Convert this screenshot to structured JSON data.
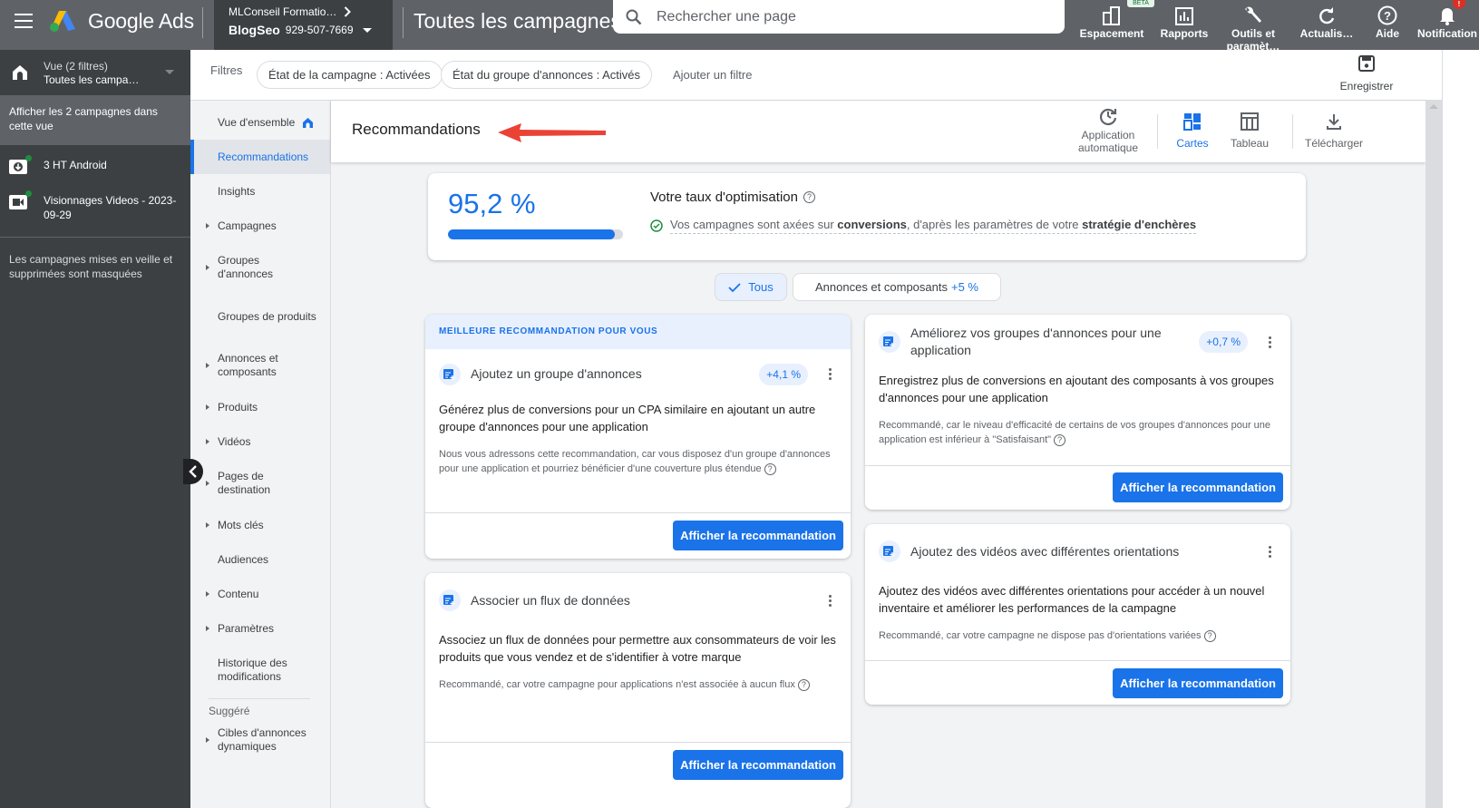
{
  "topbar": {
    "brand": "Google Ads",
    "account_parent": "MLConseil Formatio…",
    "account_name": "BlogSeo",
    "account_id": "929-507-7669",
    "page_title": "Toutes les campagnes",
    "search_placeholder": "Rechercher une page",
    "beta_badge": "BETA",
    "notification_count": "!",
    "tools": [
      {
        "label": "Espacement",
        "icon": "workspace-icon"
      },
      {
        "label": "Rapports",
        "icon": "reports-icon"
      },
      {
        "label": "Outils et paramèt…",
        "icon": "wrench-icon"
      },
      {
        "label": "Actualis…",
        "icon": "refresh-icon"
      },
      {
        "label": "Aide",
        "icon": "help-icon"
      },
      {
        "label": "Notification",
        "icon": "bell-icon"
      }
    ]
  },
  "leftpanel": {
    "view_line1": "Vue (2 filtres)",
    "view_line2": "Toutes les campa…",
    "show_all": "Afficher les 2 campagnes dans cette vue",
    "campaigns": [
      {
        "name": "3 HT Android",
        "icon": "app-download-icon",
        "status_color": "#1e8e3e"
      },
      {
        "name": "Visionnages Videos - 2023-09-29",
        "icon": "video-camera-icon",
        "status_color": "#1e8e3e"
      }
    ],
    "hidden_note": "Les campagnes mises en veille et supprimées sont masquées"
  },
  "filterbar": {
    "label": "Filtres",
    "chips": [
      "État de la campagne : Activées",
      "État du groupe d'annonces : Activés"
    ],
    "add_filter": "Ajouter un filtre",
    "save_label": "Enregistrer"
  },
  "nav": {
    "items": [
      {
        "label": "Vue d'ensemble",
        "expandable": false,
        "home": true
      },
      {
        "label": "Recommandations",
        "expandable": false,
        "active": true
      },
      {
        "label": "Insights",
        "expandable": false
      },
      {
        "label": "Campagnes",
        "expandable": true
      },
      {
        "label": "Groupes d'annonces",
        "expandable": true
      },
      {
        "label": "Groupes de produits",
        "expandable": false
      },
      {
        "label": "Annonces et composants",
        "expandable": true
      },
      {
        "label": "Produits",
        "expandable": true
      },
      {
        "label": "Vidéos",
        "expandable": true
      },
      {
        "label": "Pages de destination",
        "expandable": true
      },
      {
        "label": "Mots clés",
        "expandable": true
      },
      {
        "label": "Audiences",
        "expandable": false
      },
      {
        "label": "Contenu",
        "expandable": true
      },
      {
        "label": "Paramètres",
        "expandable": true
      },
      {
        "label": "Historique des modifications",
        "expandable": false
      }
    ],
    "section_label": "Suggéré",
    "suggested": [
      {
        "label": "Cibles d'annonces dynamiques",
        "expandable": true
      }
    ]
  },
  "header": {
    "title": "Recommandations",
    "tools": [
      {
        "label": "Application automatique",
        "icon": "auto-apply-icon"
      },
      {
        "label": "Cartes",
        "icon": "cards-view-icon",
        "active": true
      },
      {
        "label": "Tableau",
        "icon": "table-view-icon"
      },
      {
        "label": "Télécharger",
        "icon": "download-icon"
      }
    ]
  },
  "score": {
    "value": "95,2 %",
    "progress_percent": 95.2,
    "title": "Votre taux d'optimisation",
    "desc_pre": "Vos campagnes sont axées sur ",
    "desc_bold1": "conversions",
    "desc_mid": ", d'après les paramètres de votre ",
    "desc_bold2": "stratégie d'enchères"
  },
  "segments": {
    "all_label": "Tous",
    "ads_label": "Annonces et composants",
    "ads_uplift": "+5 %"
  },
  "cards": [
    {
      "banner": "MEILLEURE RECOMMANDATION POUR VOUS",
      "title": "Ajoutez un groupe d'annonces",
      "uplift": "+4,1 %",
      "body": "Générez plus de conversions pour un CPA similaire en ajoutant un autre groupe d'annonces pour une application",
      "reason": "Nous vous adressons cette recommandation, car vous disposez d'un groupe d'annonces pour une application et pourriez bénéficier d'une couverture plus étendue",
      "button": "Afficher la recommandation"
    },
    {
      "title": "Associer un flux de données",
      "uplift": "",
      "body": "Associez un flux de données pour permettre aux consommateurs de voir les produits que vous vendez et de s'identifier à votre marque",
      "reason": "Recommandé, car votre campagne pour applications n'est associée à aucun flux",
      "button": "Afficher la recommandation"
    },
    {
      "title": "Améliorez vos groupes d'annonces pour une application",
      "uplift": "+0,7 %",
      "body": "Enregistrez plus de conversions en ajoutant des composants à vos groupes d'annonces pour une application",
      "reason": "Recommandé, car le niveau d'efficacité de certains de vos groupes d'annonces pour une application est inférieur à \"Satisfaisant\"",
      "button": "Afficher la recommandation"
    },
    {
      "title": "Ajoutez des vidéos avec différentes orientations",
      "uplift": "",
      "body": "Ajoutez des vidéos avec différentes orientations pour accéder à un nouvel inventaire et améliorer les performances de la campagne",
      "reason": "Recommandé, car votre campagne ne dispose pas d'orientations variées",
      "button": "Afficher la recommandation"
    }
  ],
  "colors": {
    "accent": "#1a73e8",
    "topbar": "#5f6368",
    "annotation_arrow": "#ea4335"
  }
}
